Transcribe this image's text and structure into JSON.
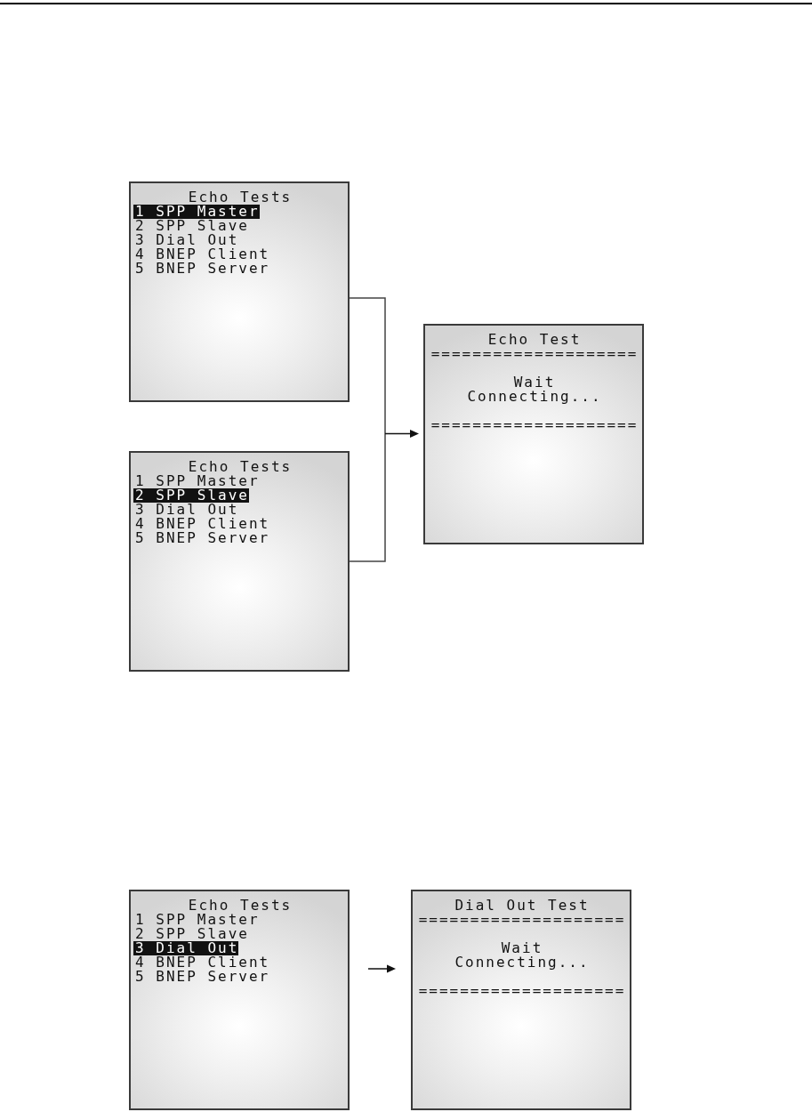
{
  "flows": [
    {
      "menu_screens": [
        {
          "title": "Echo Tests",
          "items": [
            {
              "label": "1 SPP Master",
              "selected": true
            },
            {
              "label": "2 SPP Slave",
              "selected": false
            },
            {
              "label": "3 Dial Out",
              "selected": false
            },
            {
              "label": "4 BNEP Client",
              "selected": false
            },
            {
              "label": "5 BNEP Server",
              "selected": false
            }
          ]
        },
        {
          "title": "Echo Tests",
          "items": [
            {
              "label": "1 SPP Master",
              "selected": false
            },
            {
              "label": "2 SPP Slave",
              "selected": true
            },
            {
              "label": "3 Dial Out",
              "selected": false
            },
            {
              "label": "4 BNEP Client",
              "selected": false
            },
            {
              "label": "5 BNEP Server",
              "selected": false
            }
          ]
        }
      ],
      "result_screen": {
        "title": "Echo Test",
        "rule_top": "====================",
        "message": [
          "Wait",
          "Connecting..."
        ],
        "rule_bottom": "===================="
      }
    },
    {
      "menu_screens": [
        {
          "title": "Echo Tests",
          "items": [
            {
              "label": "1 SPP Master",
              "selected": false
            },
            {
              "label": "2 SPP Slave",
              "selected": false
            },
            {
              "label": "3 Dial Out",
              "selected": true
            },
            {
              "label": "4 BNEP Client",
              "selected": false
            },
            {
              "label": "5 BNEP Server",
              "selected": false
            }
          ]
        }
      ],
      "result_screen": {
        "title": "Dial Out Test",
        "rule_top": "====================",
        "message": [
          "Wait",
          "Connecting..."
        ],
        "rule_bottom": "===================="
      }
    }
  ]
}
